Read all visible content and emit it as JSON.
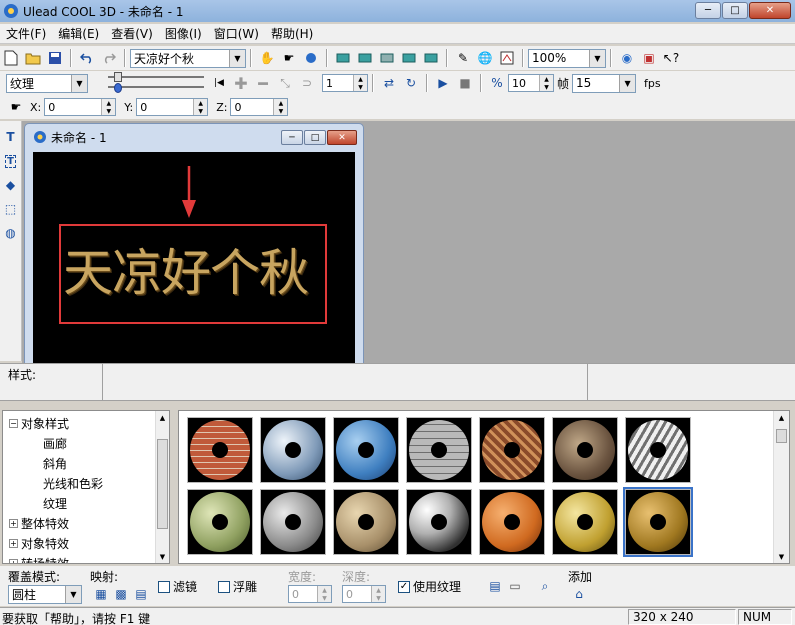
{
  "window": {
    "title": "Ulead COOL 3D - 未命名 - 1",
    "minimize": "─",
    "maximize": "□",
    "close": "✕"
  },
  "menu": [
    "文件(F)",
    "编辑(E)",
    "查看(V)",
    "图像(I)",
    "窗口(W)",
    "帮助(H)"
  ],
  "toolbar1": {
    "text_combo": "天凉好个秋",
    "zoom_combo": "100%"
  },
  "toolbar2": {
    "attribute_combo": "纹理",
    "frame_field": "1",
    "frame_count_field": "10",
    "frame_label": "帧",
    "fps_combo": "15",
    "fps_label": "fps"
  },
  "toolbar3": {
    "x_label": "X:",
    "x_value": "0",
    "y_label": "Y:",
    "y_value": "0",
    "z_label": "Z:",
    "z_value": "0"
  },
  "document": {
    "title": "未命名 - 1",
    "canvas_text": "天凉好个秋"
  },
  "style_row": {
    "label": "样式:"
  },
  "tree": {
    "items": [
      {
        "label": "对象样式",
        "box": "−"
      },
      {
        "label": "画廊",
        "box": ""
      },
      {
        "label": "斜角",
        "box": ""
      },
      {
        "label": "光线和色彩",
        "box": ""
      },
      {
        "label": "纹理",
        "box": ""
      },
      {
        "label": "整体特效",
        "box": "+"
      },
      {
        "label": "对象特效",
        "box": "+"
      },
      {
        "label": "转场特效",
        "box": "+"
      }
    ]
  },
  "gallery": {
    "thumbs": [
      {
        "name": "brick-texture"
      },
      {
        "name": "ice-texture"
      },
      {
        "name": "water-drop-texture"
      },
      {
        "name": "stone-wall-texture"
      },
      {
        "name": "rust-brick-texture"
      },
      {
        "name": "rock-texture"
      },
      {
        "name": "silver-texture"
      },
      {
        "name": "moss-texture"
      },
      {
        "name": "granite-texture"
      },
      {
        "name": "sand-texture"
      },
      {
        "name": "chrome-texture"
      },
      {
        "name": "copper-texture"
      },
      {
        "name": "gold-texture"
      },
      {
        "name": "bronze-texture"
      }
    ]
  },
  "bottom": {
    "overlay_mode_label": "覆盖模式:",
    "overlay_mode_value": "圆柱",
    "mapping_label": "映射:",
    "filter_label": "滤镜",
    "emboss_label": "浮雕",
    "width_label": "宽度:",
    "width_value": "0",
    "depth_label": "深度:",
    "depth_value": "0",
    "use_texture_label": "使用纹理",
    "use_texture_check": "✓",
    "add_label": "添加"
  },
  "status": {
    "help_text": "要获取「帮助」，请按 F1 键",
    "dimensions": "320 x 240",
    "num": "NUM"
  },
  "colors": {
    "canvas_text": "#c8a560",
    "highlight_rect": "#e13a3a"
  }
}
